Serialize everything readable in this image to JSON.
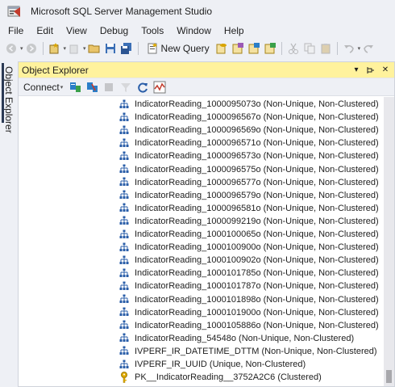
{
  "window": {
    "title": "Microsoft SQL Server Management Studio"
  },
  "menu": [
    "File",
    "Edit",
    "View",
    "Debug",
    "Tools",
    "Window",
    "Help"
  ],
  "toolbar": {
    "new_query_label": "New Query"
  },
  "side_tab": {
    "label": "Object Explorer"
  },
  "object_explorer": {
    "title": "Object Explorer",
    "connect_label": "Connect",
    "items": [
      {
        "icon": "index-icon",
        "label": "IndicatorReading_1000095073o (Non-Unique, Non-Clustered)"
      },
      {
        "icon": "index-icon",
        "label": "IndicatorReading_1000096567o (Non-Unique, Non-Clustered)"
      },
      {
        "icon": "index-icon",
        "label": "IndicatorReading_1000096569o (Non-Unique, Non-Clustered)"
      },
      {
        "icon": "index-icon",
        "label": "IndicatorReading_1000096571o (Non-Unique, Non-Clustered)"
      },
      {
        "icon": "index-icon",
        "label": "IndicatorReading_1000096573o (Non-Unique, Non-Clustered)"
      },
      {
        "icon": "index-icon",
        "label": "IndicatorReading_1000096575o (Non-Unique, Non-Clustered)"
      },
      {
        "icon": "index-icon",
        "label": "IndicatorReading_1000096577o (Non-Unique, Non-Clustered)"
      },
      {
        "icon": "index-icon",
        "label": "IndicatorReading_1000096579o (Non-Unique, Non-Clustered)"
      },
      {
        "icon": "index-icon",
        "label": "IndicatorReading_1000096581o (Non-Unique, Non-Clustered)"
      },
      {
        "icon": "index-icon",
        "label": "IndicatorReading_1000099219o (Non-Unique, Non-Clustered)"
      },
      {
        "icon": "index-icon",
        "label": "IndicatorReading_1000100065o (Non-Unique, Non-Clustered)"
      },
      {
        "icon": "index-icon",
        "label": "IndicatorReading_1000100900o (Non-Unique, Non-Clustered)"
      },
      {
        "icon": "index-icon",
        "label": "IndicatorReading_1000100902o (Non-Unique, Non-Clustered)"
      },
      {
        "icon": "index-icon",
        "label": "IndicatorReading_1000101785o (Non-Unique, Non-Clustered)"
      },
      {
        "icon": "index-icon",
        "label": "IndicatorReading_1000101787o (Non-Unique, Non-Clustered)"
      },
      {
        "icon": "index-icon",
        "label": "IndicatorReading_1000101898o (Non-Unique, Non-Clustered)"
      },
      {
        "icon": "index-icon",
        "label": "IndicatorReading_1000101900o (Non-Unique, Non-Clustered)"
      },
      {
        "icon": "index-icon",
        "label": "IndicatorReading_1000105886o (Non-Unique, Non-Clustered)"
      },
      {
        "icon": "index-icon",
        "label": "IndicatorReading_54548o (Non-Unique, Non-Clustered)"
      },
      {
        "icon": "index-icon",
        "label": "IVPERF_IR_DATETIME_DTTM (Non-Unique, Non-Clustered)"
      },
      {
        "icon": "index-icon",
        "label": "IVPERF_IR_UUID (Unique, Non-Clustered)"
      },
      {
        "icon": "key-icon",
        "label": "PK__IndicatorReading__3752A2C6 (Clustered)"
      }
    ]
  },
  "colors": {
    "panel_header": "#fff29d",
    "index_icon": "#2a5ea8",
    "key_icon": "#d9a400",
    "accent": "#68217a"
  }
}
